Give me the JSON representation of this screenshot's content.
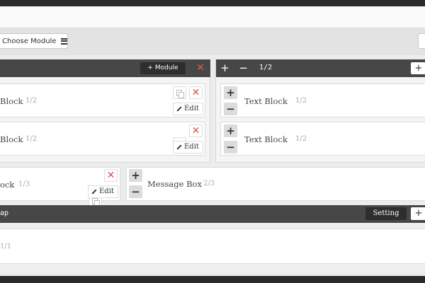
{
  "toolbar": {
    "choose_module_label": "Choose Module"
  },
  "left_section": {
    "add_module_label": "+ Module",
    "blocks": [
      {
        "title": "Block",
        "fraction": "1/2",
        "edit_label": "Edit"
      },
      {
        "title": "Block",
        "fraction": "1/2",
        "edit_label": "Edit"
      }
    ]
  },
  "right_section": {
    "plus": "+",
    "minus": "−",
    "fraction": "1/2",
    "blocks": [
      {
        "title": "Text Block",
        "fraction": "1/2"
      },
      {
        "title": "Text Block",
        "fraction": "1/2"
      }
    ]
  },
  "middle_row": {
    "left_block": {
      "title": "ock",
      "fraction": "1/3",
      "edit_label": "Edit"
    },
    "message_box": {
      "title": "Message Box",
      "fraction": "2/3"
    }
  },
  "bottom_section": {
    "title": "ap",
    "setting_label": "Setting",
    "plus": "+",
    "content_fraction": "1/1"
  },
  "colors": {
    "accent_dark": "#474747",
    "delete_red": "#d9534f"
  }
}
